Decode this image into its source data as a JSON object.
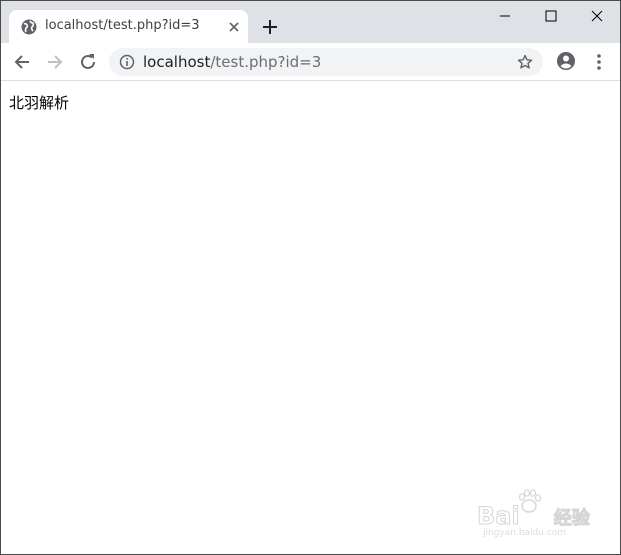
{
  "tab": {
    "title": "localhost/test.php?id=3"
  },
  "address_bar": {
    "host": "localhost",
    "path": "/test.php?id=3"
  },
  "icons": {
    "favicon": "globe-icon",
    "tab_close": "close-icon",
    "new_tab": "plus-icon",
    "minimize": "minimize-icon",
    "maximize": "maximize-icon",
    "close_window": "close-icon",
    "back": "back-arrow-icon",
    "forward": "forward-arrow-icon",
    "reload": "reload-icon",
    "site_info": "info-icon",
    "bookmark": "star-icon",
    "profile": "profile-icon",
    "menu": "more-vert-icon"
  },
  "page": {
    "body_text": "北羽解析"
  },
  "watermark": {
    "brand": "Bai",
    "brand2": "经验",
    "sub": "jingyan.baidu.com"
  },
  "colors": {
    "titlebar": "#dee1e6",
    "omnibox": "#f1f3f4",
    "icon": "#5f6368",
    "forward_disabled": "#bdc1c6"
  }
}
